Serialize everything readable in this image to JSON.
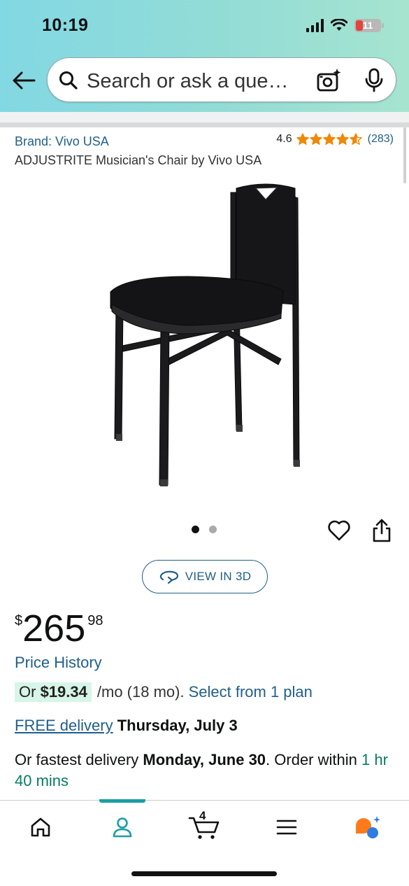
{
  "status_bar": {
    "time": "10:19",
    "battery": "11",
    "icons": [
      "signal-icon",
      "wifi-icon",
      "battery-icon"
    ]
  },
  "search": {
    "placeholder": "Search or ask a que…",
    "icons": [
      "search-icon",
      "camera-icon",
      "mic-icon"
    ]
  },
  "product": {
    "brand": "Brand: Vivo USA",
    "title": "ADJUSTRITE Musician's Chair by Vivo USA",
    "rating_value": "4.6",
    "rating_stars": 4.6,
    "rating_count": "(283)",
    "image_alt": "black folding musician's chair",
    "carousel": {
      "total": 2,
      "active": 1
    },
    "view_3d_label": "VIEW IN 3D",
    "price": {
      "currency": "$",
      "whole": "265",
      "fraction": "98"
    },
    "price_history_label": "Price History",
    "installment": {
      "prefix": "Or",
      "amount": "$19.34",
      "term": "/mo (18 mo).",
      "link": "Select from 1 plan"
    },
    "delivery": {
      "free_label": "FREE delivery",
      "date": "Thursday, July 3"
    },
    "fastest": {
      "prefix": "Or fastest delivery",
      "date": "Monday, June 30",
      "middle": ". Order within",
      "countdown": "1 hr 40 mins"
    }
  },
  "bottom_nav": {
    "items": [
      "home-icon",
      "account-icon",
      "cart-icon",
      "menu-icon",
      "assistant-icon"
    ],
    "active": "account-icon",
    "cart_count": "4"
  },
  "colors": {
    "link": "#1f5f8b",
    "star": "#f08804",
    "accent": "#1a9fa3",
    "chip": "#d7f5e9"
  }
}
